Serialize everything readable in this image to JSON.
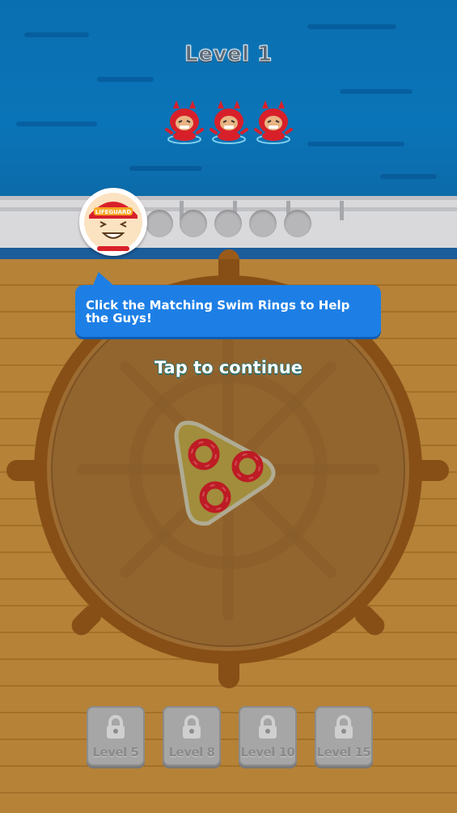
{
  "header": {
    "level_title": "Level 1"
  },
  "avatar": {
    "badge_text": "LIFEGUARD",
    "icon": "lifeguard-mascot-icon"
  },
  "tutorial": {
    "message": "Click the Matching Swim Rings to Help the Guys!",
    "prompt": "Tap to continue"
  },
  "swimmers": {
    "count": 3,
    "icon": "swimmer-guy-icon"
  },
  "slots": {
    "empty_count": 5
  },
  "rings": {
    "count": 3,
    "color": "#d8202a",
    "icon": "swim-ring-icon"
  },
  "locked_levels": [
    {
      "label": "Level 5"
    },
    {
      "label": "Level 8"
    },
    {
      "label": "Level 10"
    },
    {
      "label": "Level 15"
    }
  ],
  "colors": {
    "sea": "#0a74b8",
    "deck": "#cf9540",
    "bubble": "#1d7fe6",
    "wheel": "#9a5a1a"
  }
}
